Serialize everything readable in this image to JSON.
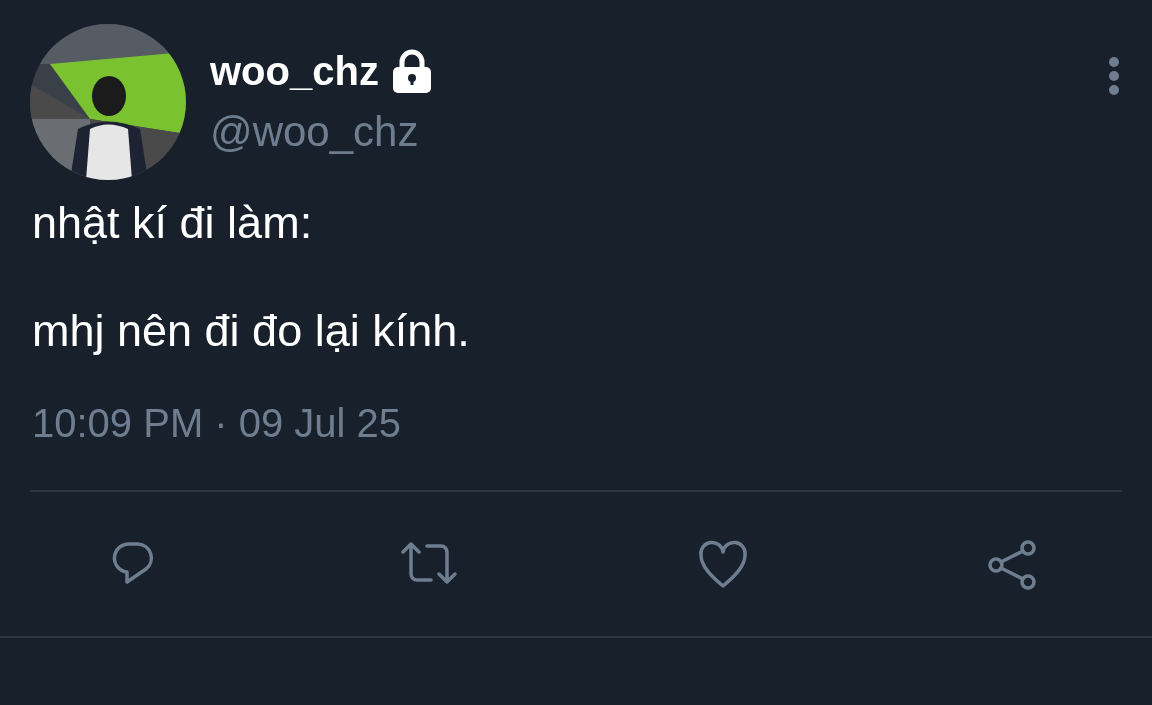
{
  "author": {
    "name": "woo_chz",
    "handle": "@woo_chz",
    "protected": true
  },
  "text": [
    "nhật kí đi làm:",
    "mhj nên đi đo lại kính."
  ],
  "timestamp": "10:09 PM · 09 Jul 25",
  "actions": [
    {
      "kind": "reply"
    },
    {
      "kind": "retweet"
    },
    {
      "kind": "like"
    },
    {
      "kind": "share"
    }
  ]
}
